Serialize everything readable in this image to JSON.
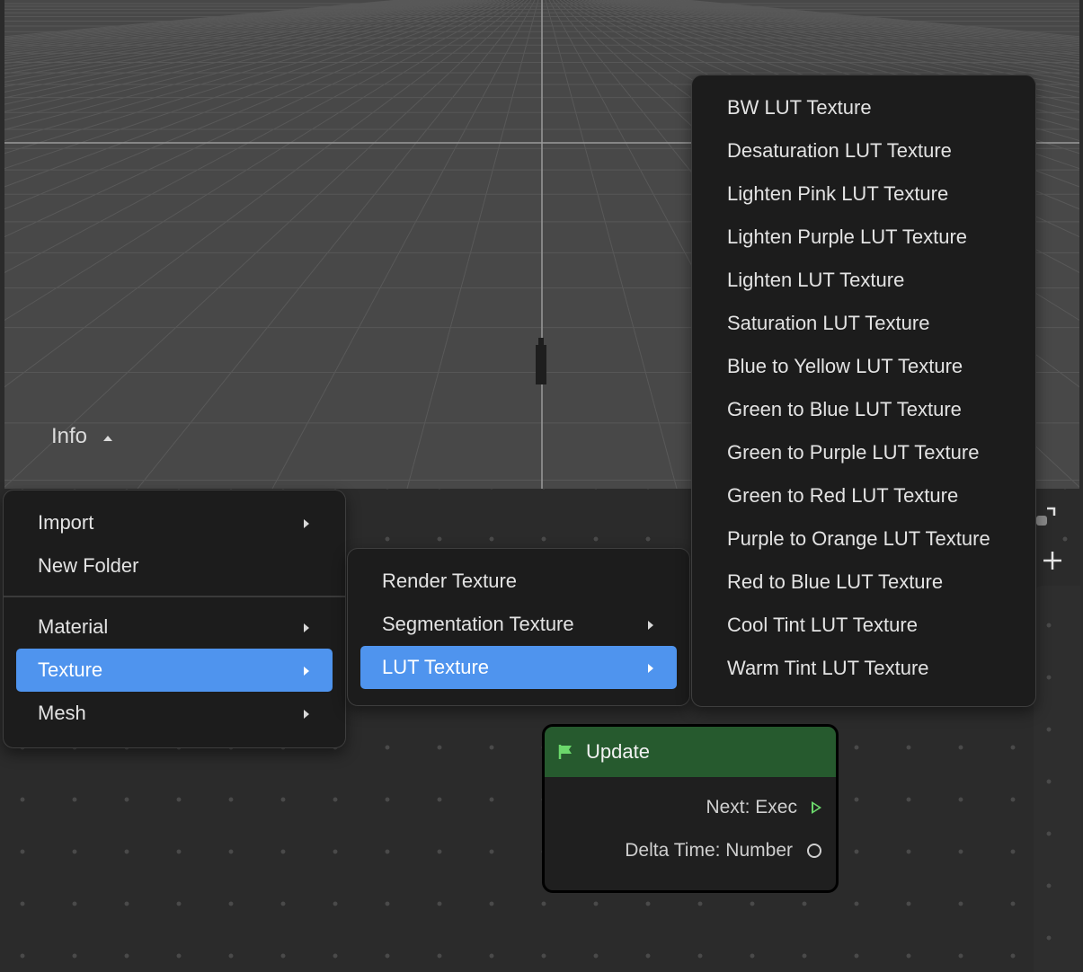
{
  "viewport": {
    "info_label": "Info"
  },
  "context_menu": {
    "items_top": [
      {
        "label": "Import",
        "has_submenu": true
      },
      {
        "label": "New Folder",
        "has_submenu": false
      }
    ],
    "items_bottom": [
      {
        "label": "Material",
        "has_submenu": true
      },
      {
        "label": "Texture",
        "has_submenu": true,
        "active": true
      },
      {
        "label": "Mesh",
        "has_submenu": true
      }
    ]
  },
  "texture_submenu": {
    "items": [
      {
        "label": "Render Texture",
        "has_submenu": false
      },
      {
        "label": "Segmentation Texture",
        "has_submenu": true
      },
      {
        "label": "LUT Texture",
        "has_submenu": true,
        "active": true
      }
    ]
  },
  "lut_submenu": {
    "items": [
      "BW LUT Texture",
      "Desaturation LUT Texture",
      "Lighten Pink LUT Texture",
      "Lighten Purple LUT Texture",
      "Lighten LUT Texture",
      "Saturation LUT Texture",
      "Blue to Yellow LUT Texture",
      "Green to Blue LUT Texture",
      "Green to Purple LUT Texture",
      "Green to Red LUT Texture",
      "Purple to Orange LUT Texture",
      "Red to Blue LUT Texture",
      "Cool Tint LUT Texture",
      "Warm Tint LUT Texture"
    ]
  },
  "node": {
    "title": "Update",
    "icon": "flag-icon",
    "outputs": [
      {
        "label": "Next: Exec",
        "pin": "exec"
      },
      {
        "label": "Delta Time: Number",
        "pin": "number"
      }
    ]
  },
  "colors": {
    "accent": "#4f94ee",
    "node_header": "#265a2e",
    "exec_pin": "#6bd86b"
  }
}
